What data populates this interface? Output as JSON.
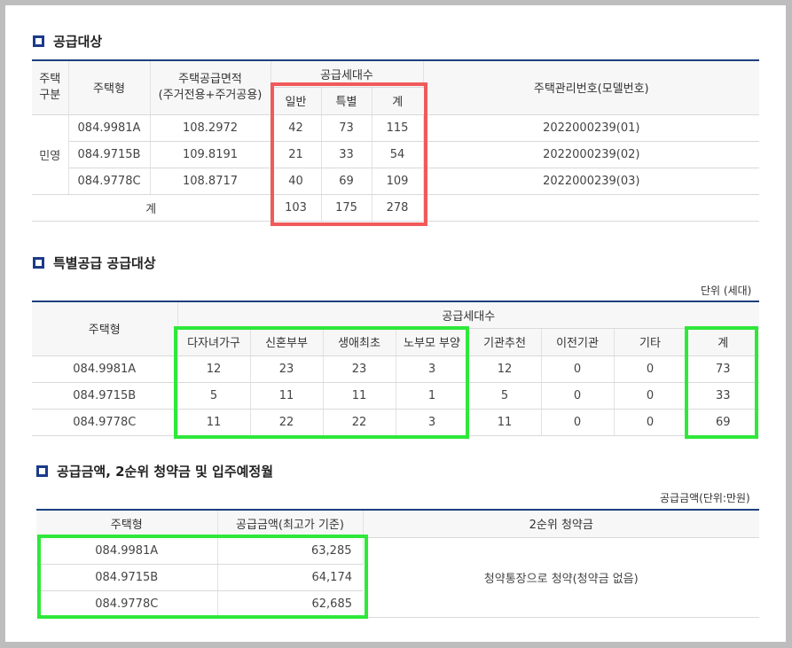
{
  "section1": {
    "title": "공급대상",
    "headers": {
      "type_group": "주택\n구분",
      "type": "주택형",
      "area": "주택공급면적\n(주거전용+주거공용)",
      "households": "공급세대수",
      "general": "일반",
      "special": "특별",
      "total": "계",
      "model_no": "주택관리번호(모델번호)"
    },
    "group_label": "민영",
    "rows": [
      {
        "type": "084.9981A",
        "area": "108.2972",
        "general": "42",
        "special": "73",
        "total": "115",
        "model": "2022000239(01)"
      },
      {
        "type": "084.9715B",
        "area": "109.8191",
        "general": "21",
        "special": "33",
        "total": "54",
        "model": "2022000239(02)"
      },
      {
        "type": "084.9778C",
        "area": "108.8717",
        "general": "40",
        "special": "69",
        "total": "109",
        "model": "2022000239(03)"
      }
    ],
    "sum": {
      "label": "계",
      "general": "103",
      "special": "175",
      "total": "278"
    }
  },
  "section2": {
    "title": "특별공급 공급대상",
    "unit": "단위 (세대)",
    "headers": {
      "type": "주택형",
      "households": "공급세대수",
      "cols": [
        "다자녀가구",
        "신혼부부",
        "생애최초",
        "노부모 부양",
        "기관추천",
        "이전기관",
        "기타",
        "계"
      ]
    },
    "rows": [
      {
        "type": "084.9981A",
        "vals": [
          "12",
          "23",
          "23",
          "3",
          "12",
          "0",
          "0",
          "73"
        ]
      },
      {
        "type": "084.9715B",
        "vals": [
          "5",
          "11",
          "11",
          "1",
          "5",
          "0",
          "0",
          "33"
        ]
      },
      {
        "type": "084.9778C",
        "vals": [
          "11",
          "22",
          "22",
          "3",
          "11",
          "0",
          "0",
          "69"
        ]
      }
    ]
  },
  "section3": {
    "title": "공급금액, 2순위 청약금 및 입주예정월",
    "unit": "공급금액(단위:만원)",
    "headers": {
      "type": "주택형",
      "price": "공급금액(최고가 기준)",
      "deposit": "2순위 청약금"
    },
    "rows": [
      {
        "type": "084.9981A",
        "price": "63,285"
      },
      {
        "type": "084.9715B",
        "price": "64,174"
      },
      {
        "type": "084.9778C",
        "price": "62,685"
      }
    ],
    "deposit_note": "청약통장으로 청약(청약금 없음)"
  },
  "colors": {
    "navy": "#1e3f7d",
    "red_highlight": "#f05a5a",
    "green_highlight": "#2ee83a"
  }
}
